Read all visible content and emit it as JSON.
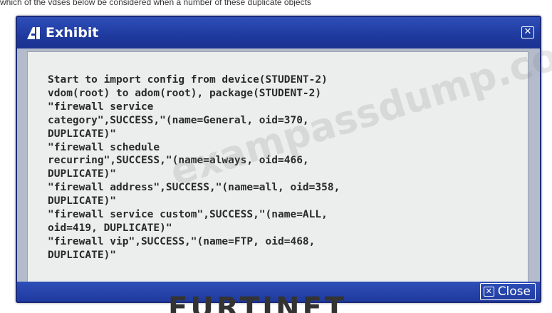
{
  "top_strip": {
    "text": "which of the vdses below be considered when a number of these duplicate objects"
  },
  "dialog": {
    "title": "Exhibit",
    "icons": {
      "title": "fortinet-logo-icon",
      "close": "close-x-icon"
    },
    "close_button_label": "Close",
    "log_lines": [
      "Start to import config from device(STUDENT-2)",
      "vdom(root) to adom(root), package(STUDENT-2)",
      "\"firewall service",
      "category\",SUCCESS,\"(name=General, oid=370,",
      "DUPLICATE)\"",
      "\"firewall schedule",
      "recurring\",SUCCESS,\"(name=always, oid=466,",
      "DUPLICATE)\"",
      "\"firewall address\",SUCCESS,\"(name=all, oid=358,",
      "DUPLICATE)\"",
      "\"firewall service custom\",SUCCESS,\"(name=ALL,",
      "oid=419, DUPLICATE)\"",
      "\"firewall vip\",SUCCESS,\"(name=FTP, oid=468,",
      "DUPLICATE)\""
    ]
  },
  "watermark": "exampassdump.com",
  "brand": "FURTINET",
  "colors": {
    "titlebar": "#1f3a9e",
    "content_bg": "#eceeed",
    "text": "#2a2a2a"
  }
}
